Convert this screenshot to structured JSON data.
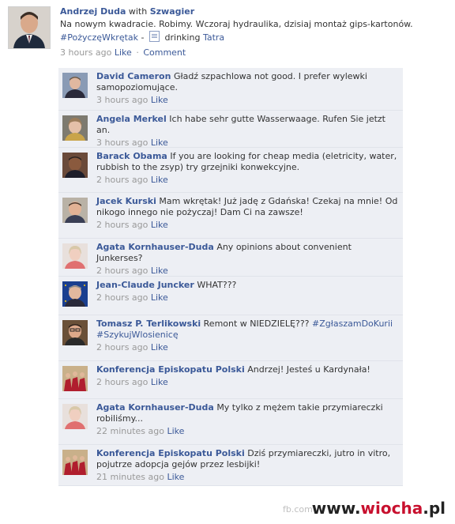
{
  "post": {
    "author": "Andrzej Duda",
    "with_word": "with",
    "tagged": "Szwagier",
    "text": "Na nowym kwadracie. Robimy. Wczoraj hydraulika, dzisiaj montaż gips-kartonów.",
    "hashtag": "#PożyczęWkrętak",
    "dash": "-",
    "activity": "drinking",
    "activity_object": "Tatra",
    "time": "3 hours ago",
    "like_label": "Like",
    "separator": "·",
    "comment_label": "Comment"
  },
  "comments": [
    {
      "name": "David Cameron",
      "text": "Gładź szpachlowa not good. I prefer wylewki samopoziomujące.",
      "time": "3 hours ago",
      "like": "Like"
    },
    {
      "name": "Angela Merkel",
      "text": "Ich habe sehr gutte Wasserwaage. Rufen Sie jetzt an.",
      "time": "3 hours ago",
      "like": "Like"
    },
    {
      "name": "Barack Obama",
      "text": "If you are looking for cheap media (eletricity, water, rubbish to the zsyp) try grzejniki konwekcyjne.",
      "time": "2 hours ago",
      "like": "Like"
    },
    {
      "name": "Jacek Kurski",
      "text": "Mam wkrętak! Już jadę z Gdańska! Czekaj na mnie! Od nikogo innego nie pożyczaj! Dam Ci na zawsze!",
      "time": "2 hours ago",
      "like": "Like"
    },
    {
      "name": "Agata Kornhauser-Duda",
      "text": "Any opinions about convenient Junkerses?",
      "time": "2 hours ago",
      "like": "Like"
    },
    {
      "name": "Jean-Claude Juncker",
      "text": "WHAT???",
      "time": "2 hours ago",
      "like": "Like"
    },
    {
      "name": "Tomasz P. Terlikowski",
      "text": "Remont w NIEDZIELĘ???",
      "hashtags": "#ZgłaszamDoKurii #SzykujWlosienicę",
      "time": "2 hours ago",
      "like": "Like"
    },
    {
      "name": "Konferencja Episkopatu Polski",
      "text": "Andrzej! Jesteś u Kardynała!",
      "time": "2 hours ago",
      "like": "Like"
    },
    {
      "name": "Agata Kornhauser-Duda",
      "text": "My tylko z mężem takie przymiareczki robiliśmy...",
      "time": "22 minutes ago",
      "like": "Like"
    },
    {
      "name": "Konferencja Episkopatu Polski",
      "text": "Dziś przymiareczki, jutro in vitro, pojutrze adopcja gejów przez lesbijki!",
      "time": "21 minutes ago",
      "like": "Like"
    }
  ],
  "footer": {
    "source": "fb.com",
    "watermark_prefix": "www.",
    "watermark_site": "wiocha",
    "watermark_suffix": ".pl"
  }
}
